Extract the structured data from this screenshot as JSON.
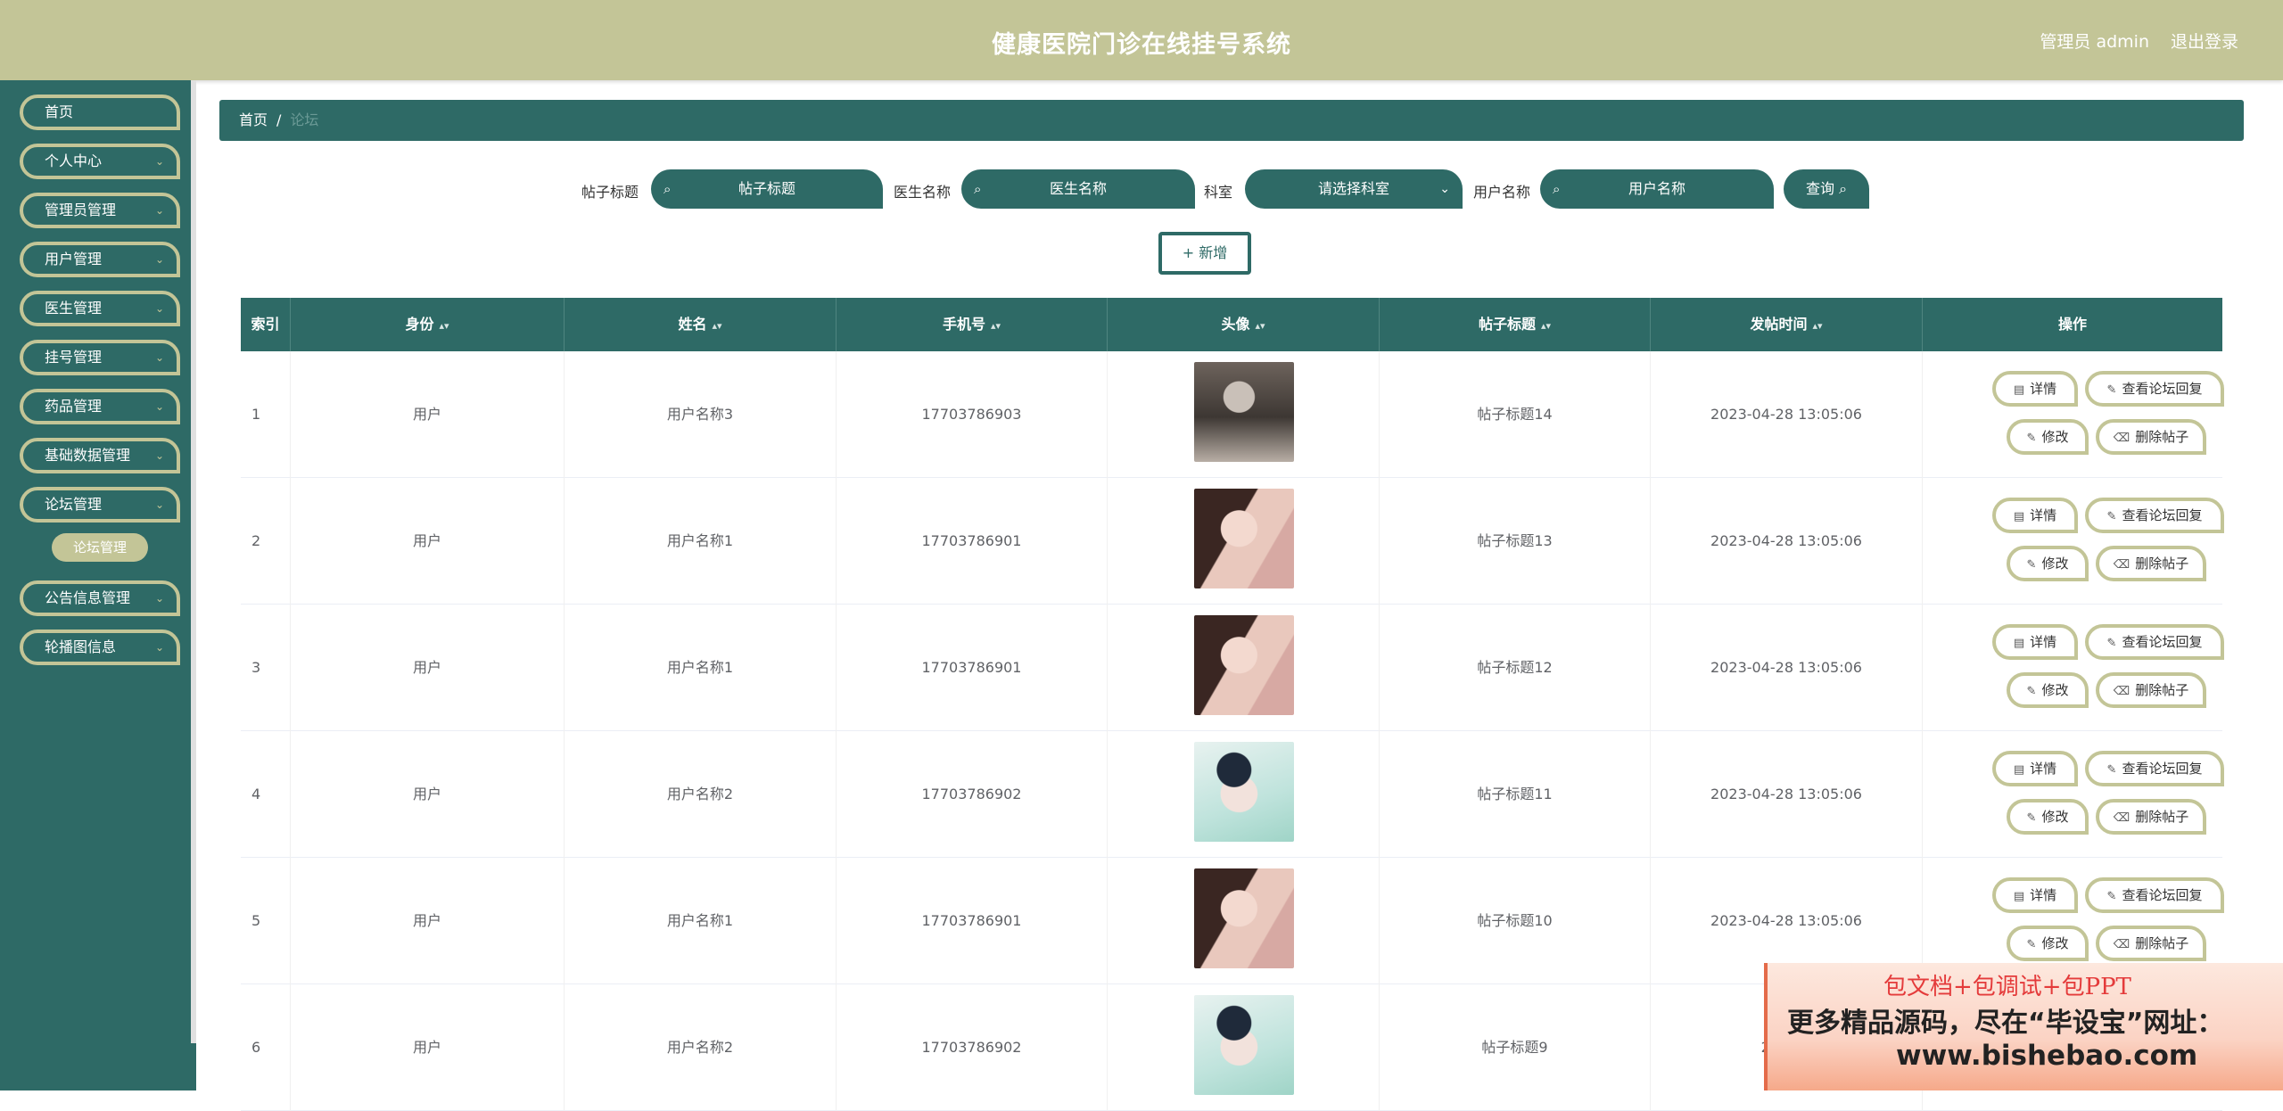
{
  "header": {
    "title": "健康医院门诊在线挂号系统",
    "admin_label": "管理员 admin",
    "logout_label": "退出登录"
  },
  "sidebar": {
    "items": [
      {
        "label": "首页"
      },
      {
        "label": "个人中心"
      },
      {
        "label": "管理员管理"
      },
      {
        "label": "用户管理"
      },
      {
        "label": "医生管理"
      },
      {
        "label": "挂号管理"
      },
      {
        "label": "药品管理"
      },
      {
        "label": "基础数据管理"
      },
      {
        "label": "论坛管理"
      },
      {
        "label": "公告信息管理"
      },
      {
        "label": "轮播图信息"
      }
    ],
    "active_sub": "论坛管理"
  },
  "breadcrumb": {
    "home": "首页",
    "separator": "/",
    "current": "论坛"
  },
  "search": {
    "post_title_label": "帖子标题",
    "post_title_placeholder": "帖子标题",
    "doctor_label": "医生名称",
    "doctor_placeholder": "医生名称",
    "dept_label": "科室",
    "dept_placeholder": "请选择科室",
    "user_label": "用户名称",
    "user_placeholder": "用户名称",
    "query_label": "查询"
  },
  "add_label": "+ 新增",
  "table": {
    "headers": [
      "索引",
      "身份",
      "姓名",
      "手机号",
      "头像",
      "帖子标题",
      "发帖时间",
      "操作"
    ],
    "rows": [
      {
        "idx": "1",
        "role": "用户",
        "name": "用户名称3",
        "phone": "17703786903",
        "avatar": "avatar-3",
        "title": "帖子标题14",
        "time": "2023-04-28 13:05:06"
      },
      {
        "idx": "2",
        "role": "用户",
        "name": "用户名称1",
        "phone": "17703786901",
        "avatar": "avatar-1",
        "title": "帖子标题13",
        "time": "2023-04-28 13:05:06"
      },
      {
        "idx": "3",
        "role": "用户",
        "name": "用户名称1",
        "phone": "17703786901",
        "avatar": "avatar-1",
        "title": "帖子标题12",
        "time": "2023-04-28 13:05:06"
      },
      {
        "idx": "4",
        "role": "用户",
        "name": "用户名称2",
        "phone": "17703786902",
        "avatar": "avatar-2",
        "title": "帖子标题11",
        "time": "2023-04-28 13:05:06"
      },
      {
        "idx": "5",
        "role": "用户",
        "name": "用户名称1",
        "phone": "17703786901",
        "avatar": "avatar-1",
        "title": "帖子标题10",
        "time": "2023-04-28 13:05:06"
      },
      {
        "idx": "6",
        "role": "用户",
        "name": "用户名称2",
        "phone": "17703786902",
        "avatar": "avatar-2",
        "title": "帖子标题9",
        "time": "2023-0"
      }
    ],
    "actions": {
      "detail": "详情",
      "view_reply": "查看论坛回复",
      "edit": "修改",
      "delete": "删除帖子"
    }
  },
  "watermark": {
    "line1": "包文档+包调试+包PPT",
    "line2": "更多精品源码，尽在“毕设宝”网址：",
    "line3": "www.bishebao.com"
  },
  "colors": {
    "header_bg": "#c3c597",
    "primary": "#2e6a66",
    "accent_border": "#c3c597"
  }
}
